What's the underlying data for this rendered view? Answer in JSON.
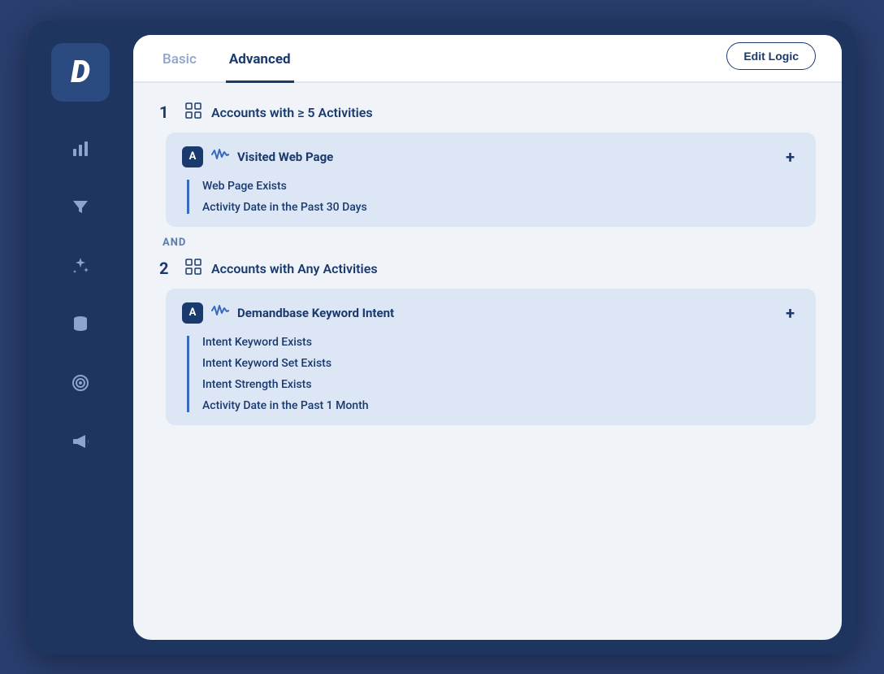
{
  "sidebar": {
    "logo": "D",
    "nav_items": [
      {
        "name": "analytics",
        "icon": "bar-chart"
      },
      {
        "name": "funnel",
        "icon": "filter"
      },
      {
        "name": "spark",
        "icon": "sparkle"
      },
      {
        "name": "database",
        "icon": "database"
      },
      {
        "name": "target",
        "icon": "target"
      },
      {
        "name": "megaphone",
        "icon": "megaphone"
      }
    ]
  },
  "tabs": {
    "basic_label": "Basic",
    "advanced_label": "Advanced",
    "active": "advanced",
    "edit_logic_label": "Edit Logic"
  },
  "sections": [
    {
      "number": "1",
      "title": "Accounts with",
      "operator": "≥",
      "value": "5 Activities",
      "activity": {
        "badge": "A",
        "name": "Visited Web Page",
        "conditions": [
          "Web Page Exists",
          "Activity Date in the Past 30 Days"
        ]
      }
    },
    {
      "number": "2",
      "title": "Accounts with Any Activities",
      "activity": {
        "badge": "A",
        "name": "Demandbase Keyword Intent",
        "conditions": [
          "Intent Keyword Exists",
          "Intent Keyword Set Exists",
          "Intent Strength Exists",
          "Activity Date in the Past 1 Month"
        ]
      }
    }
  ],
  "and_label": "AND"
}
